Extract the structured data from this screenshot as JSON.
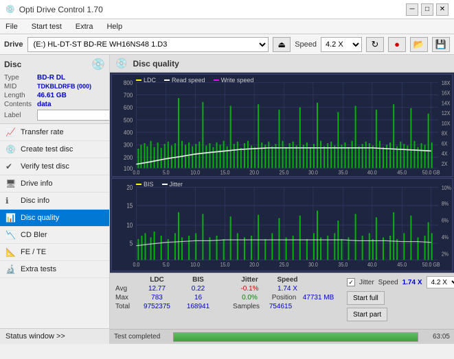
{
  "titlebar": {
    "title": "Opti Drive Control 1.70",
    "icon": "💿",
    "min_btn": "─",
    "max_btn": "□",
    "close_btn": "✕"
  },
  "menu": {
    "items": [
      "File",
      "Start test",
      "Extra",
      "Help"
    ]
  },
  "drive_toolbar": {
    "drive_label": "Drive",
    "drive_value": "(E:)  HL-DT-ST BD-RE  WH16NS48 1.D3",
    "eject_icon": "⏏",
    "speed_label": "Speed",
    "speed_value": "4.2 X",
    "icons": [
      "↻",
      "🔴",
      "🖫",
      "💾"
    ]
  },
  "disc_panel": {
    "title": "Disc",
    "type_label": "Type",
    "type_value": "BD-R DL",
    "mid_label": "MID",
    "mid_value": "TDKBLDRFB (000)",
    "length_label": "Length",
    "length_value": "46.61 GB",
    "contents_label": "Contents",
    "contents_value": "data",
    "label_label": "Label"
  },
  "nav_items": [
    {
      "id": "transfer-rate",
      "label": "Transfer rate",
      "icon": "📈"
    },
    {
      "id": "create-test-disc",
      "label": "Create test disc",
      "icon": "💿"
    },
    {
      "id": "verify-test-disc",
      "label": "Verify test disc",
      "icon": "✔"
    },
    {
      "id": "drive-info",
      "label": "Drive info",
      "icon": "🖥"
    },
    {
      "id": "disc-info",
      "label": "Disc info",
      "icon": "ℹ"
    },
    {
      "id": "disc-quality",
      "label": "Disc quality",
      "icon": "📊",
      "active": true
    },
    {
      "id": "cd-bler",
      "label": "CD Bler",
      "icon": "📉"
    },
    {
      "id": "fe-te",
      "label": "FE / TE",
      "icon": "📐"
    },
    {
      "id": "extra-tests",
      "label": "Extra tests",
      "icon": "🔬"
    }
  ],
  "status_window": "Status window >>",
  "chart_header": {
    "title": "Disc quality",
    "icon": "💿"
  },
  "chart1": {
    "legend": [
      {
        "label": "LDC",
        "color": "#ffff00"
      },
      {
        "label": "Read speed",
        "color": "#ffffff"
      },
      {
        "label": "Write speed",
        "color": "#ff00ff"
      }
    ],
    "y_max": 800,
    "y_labels": [
      "800",
      "700",
      "600",
      "500",
      "400",
      "300",
      "200",
      "100"
    ],
    "y_right_labels": [
      "18X",
      "16X",
      "14X",
      "12X",
      "10X",
      "8X",
      "6X",
      "4X",
      "2X"
    ],
    "x_labels": [
      "0.0",
      "5.0",
      "10.0",
      "15.0",
      "20.0",
      "25.0",
      "30.0",
      "35.0",
      "40.0",
      "45.0",
      "50.0 GB"
    ]
  },
  "chart2": {
    "legend": [
      {
        "label": "BIS",
        "color": "#ffff00"
      },
      {
        "label": "Jitter",
        "color": "#ffffff"
      }
    ],
    "y_max": 20,
    "y_labels": [
      "20",
      "15",
      "10",
      "5"
    ],
    "y_right_labels": [
      "10%",
      "8%",
      "6%",
      "4%",
      "2%"
    ],
    "x_labels": [
      "0.0",
      "5.0",
      "10.0",
      "15.0",
      "20.0",
      "25.0",
      "30.0",
      "35.0",
      "40.0",
      "45.0",
      "50.0 GB"
    ]
  },
  "stats": {
    "columns": [
      "LDC",
      "BIS",
      "",
      "Jitter",
      "Speed",
      ""
    ],
    "rows": [
      {
        "label": "Avg",
        "ldc": "12.77",
        "bis": "0.22",
        "jitter": "-0.1%",
        "speed": "1.74 X"
      },
      {
        "label": "Max",
        "ldc": "783",
        "bis": "16",
        "jitter": "0.0%",
        "position": "47731 MB"
      },
      {
        "label": "Total",
        "ldc": "9752375",
        "bis": "168941",
        "samples": "754615"
      }
    ],
    "jitter_checked": true,
    "jitter_label": "Jitter",
    "speed_val": "1.74 X",
    "speed_label": "Speed",
    "speed_select": "4.2 X",
    "position_label": "Position",
    "position_val": "47731 MB",
    "samples_label": "Samples",
    "samples_val": "754615",
    "start_full_label": "Start full",
    "start_part_label": "Start part"
  },
  "progress": {
    "status": "Test completed",
    "percent": 100,
    "time": "63:05"
  }
}
